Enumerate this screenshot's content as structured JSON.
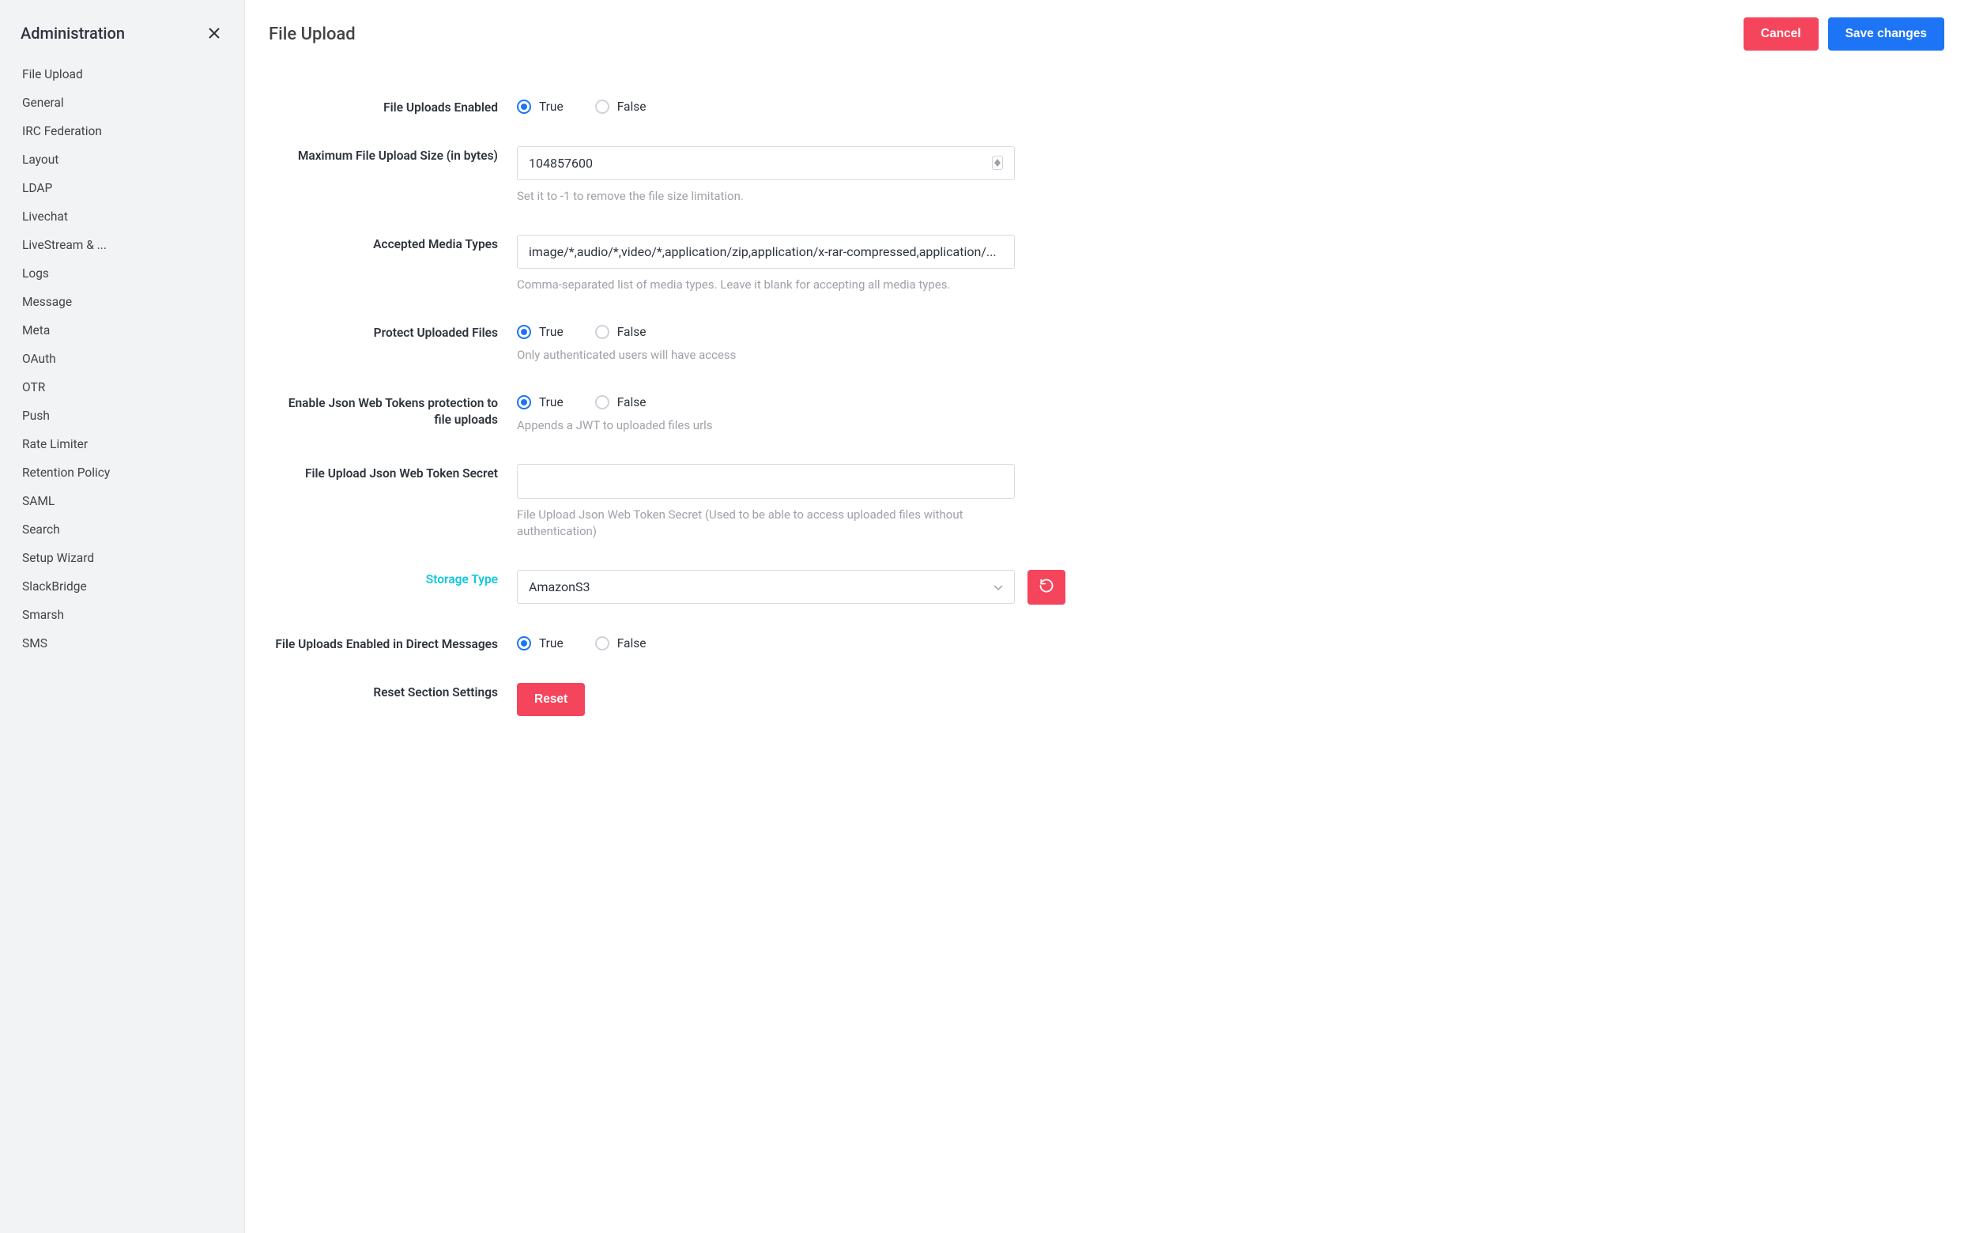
{
  "sidebar": {
    "title": "Administration",
    "items": [
      "File Upload",
      "General",
      "IRC Federation",
      "Layout",
      "LDAP",
      "Livechat",
      "LiveStream & ...",
      "Logs",
      "Message",
      "Meta",
      "OAuth",
      "OTR",
      "Push",
      "Rate Limiter",
      "Retention Policy",
      "SAML",
      "Search",
      "Setup Wizard",
      "SlackBridge",
      "Smarsh",
      "SMS"
    ]
  },
  "header": {
    "title": "File Upload",
    "cancel": "Cancel",
    "save": "Save changes"
  },
  "labels": {
    "true": "True",
    "false": "False"
  },
  "fields": {
    "uploads_enabled": {
      "label": "File Uploads Enabled",
      "value": "true"
    },
    "max_size": {
      "label": "Maximum File Upload Size (in bytes)",
      "value": "104857600",
      "help": "Set it to -1 to remove the file size limitation."
    },
    "media_types": {
      "label": "Accepted Media Types",
      "value": "image/*,audio/*,video/*,application/zip,application/x-rar-compressed,application/...",
      "help": "Comma-separated list of media types. Leave it blank for accepting all media types."
    },
    "protect": {
      "label": "Protect Uploaded Files",
      "value": "true",
      "help": "Only authenticated users will have access"
    },
    "jwt_enabled": {
      "label": "Enable Json Web Tokens protection to file uploads",
      "value": "true",
      "help": "Appends a JWT to uploaded files urls"
    },
    "jwt_secret": {
      "label": "File Upload Json Web Token Secret",
      "value": "",
      "help": "File Upload Json Web Token Secret (Used to be able to access uploaded files without authentication)"
    },
    "storage_type": {
      "label": "Storage Type",
      "value": "AmazonS3"
    },
    "dm_enabled": {
      "label": "File Uploads Enabled in Direct Messages",
      "value": "true"
    },
    "reset_section": {
      "label": "Reset Section Settings",
      "button": "Reset"
    }
  }
}
